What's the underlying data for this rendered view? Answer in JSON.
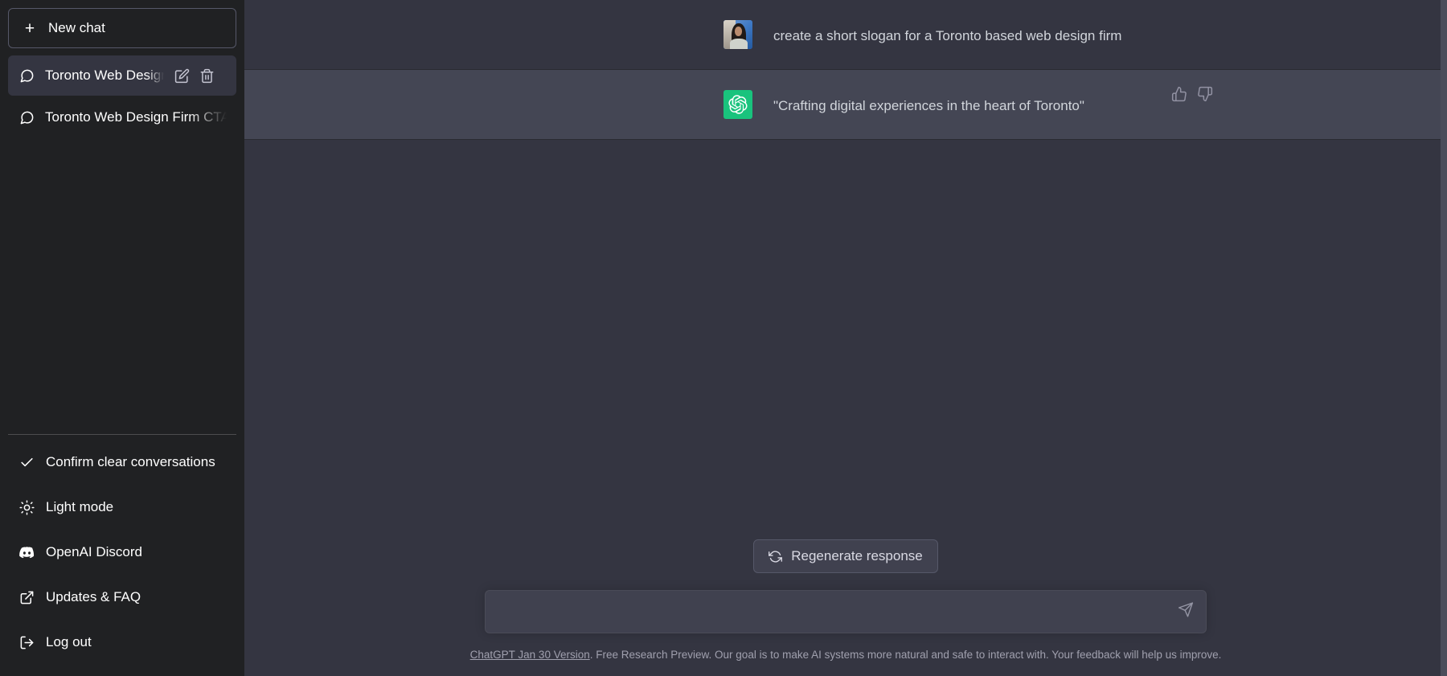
{
  "colors": {
    "sidebar_bg": "#202123",
    "user_row_bg": "#343541",
    "assistant_row_bg": "#444654",
    "composer_bg": "#40414f",
    "accent_green": "#19c37d",
    "text_primary": "#ffffff",
    "text_secondary": "#d1d5db",
    "footer_text": "#a0a0ae",
    "border": "#565869"
  },
  "sidebar": {
    "new_chat": {
      "label": "New chat",
      "icon": "plus-icon"
    },
    "chats": [
      {
        "label": "Toronto Web Design Sl",
        "icon": "message-square-icon",
        "active": true,
        "actions": [
          {
            "name": "edit-chat-title",
            "icon": "pencil-icon"
          },
          {
            "name": "delete-chat",
            "icon": "trash-icon"
          }
        ]
      },
      {
        "label": "Toronto Web Design Firm CTA",
        "icon": "message-square-icon",
        "active": false,
        "actions": []
      }
    ],
    "menu": [
      {
        "label": "Confirm clear conversations",
        "icon": "check-icon"
      },
      {
        "label": "Light mode",
        "icon": "sun-icon"
      },
      {
        "label": "OpenAI Discord",
        "icon": "discord-icon"
      },
      {
        "label": "Updates & FAQ",
        "icon": "external-link-icon"
      },
      {
        "label": "Log out",
        "icon": "logout-icon"
      }
    ]
  },
  "conversation": {
    "messages": [
      {
        "role": "user",
        "avatar": "user-photo-avatar",
        "text": "create a short slogan for a Toronto based web design firm"
      },
      {
        "role": "assistant",
        "avatar": "chatgpt-logo-avatar",
        "text": "\"Crafting digital experiences in the heart of Toronto\"",
        "feedback": [
          {
            "name": "thumbs-up-button",
            "icon": "thumbs-up-icon"
          },
          {
            "name": "thumbs-down-button",
            "icon": "thumbs-down-icon"
          }
        ]
      }
    ]
  },
  "composer": {
    "regenerate_label": "Regenerate response",
    "regenerate_icon": "refresh-icon",
    "input_value": "",
    "input_placeholder": "",
    "send_icon": "send-icon"
  },
  "footer": {
    "version_link": "ChatGPT Jan 30 Version",
    "note": ". Free Research Preview. Our goal is to make AI systems more natural and safe to interact with. Your feedback will help us improve."
  }
}
